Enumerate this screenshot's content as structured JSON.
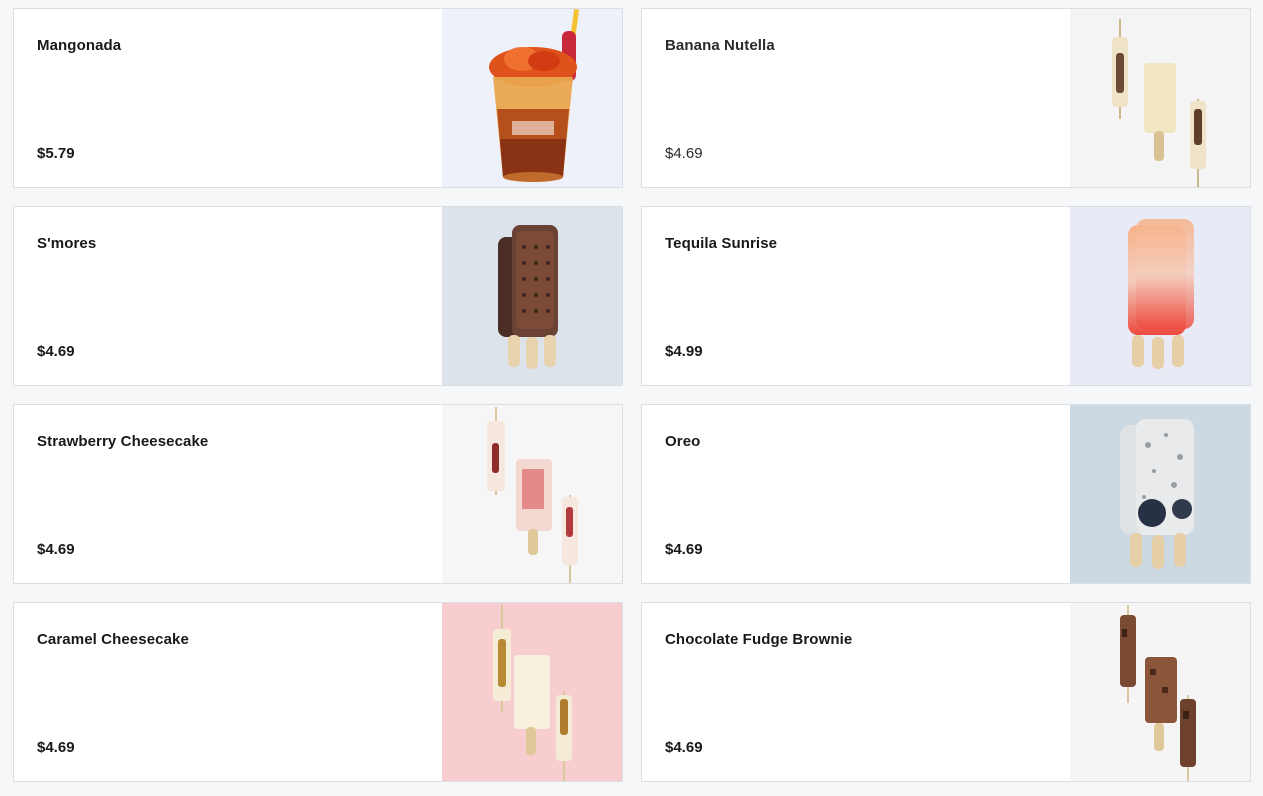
{
  "menu": {
    "items": [
      {
        "name": "Mangonada",
        "price": "$5.79",
        "image": "mangonada-cup-image",
        "bg": "#eef1f9"
      },
      {
        "name": "Banana Nutella",
        "price": "$4.69",
        "image": "banana-nutella-popsicles-image",
        "bg": "#f4f4f4"
      },
      {
        "name": "S'mores",
        "price": "$4.69",
        "image": "smores-popsicles-image",
        "bg": "#dde3ea"
      },
      {
        "name": "Tequila Sunrise",
        "price": "$4.99",
        "image": "tequila-sunrise-popsicles-image",
        "bg": "#e8ebf5"
      },
      {
        "name": "Strawberry Cheesecake",
        "price": "$4.69",
        "image": "strawberry-cheesecake-popsicles-image",
        "bg": "#f6f6f6"
      },
      {
        "name": "Oreo",
        "price": "$4.69",
        "image": "oreo-popsicles-image",
        "bg": "#ccd9e3"
      },
      {
        "name": "Caramel Cheesecake",
        "price": "$4.69",
        "image": "caramel-cheesecake-popsicles-image",
        "bg": "#f7cdd0"
      },
      {
        "name": "Chocolate Fudge Brownie",
        "price": "$4.69",
        "image": "chocolate-fudge-brownie-popsicles-image",
        "bg": "#f5f5f5"
      }
    ]
  }
}
